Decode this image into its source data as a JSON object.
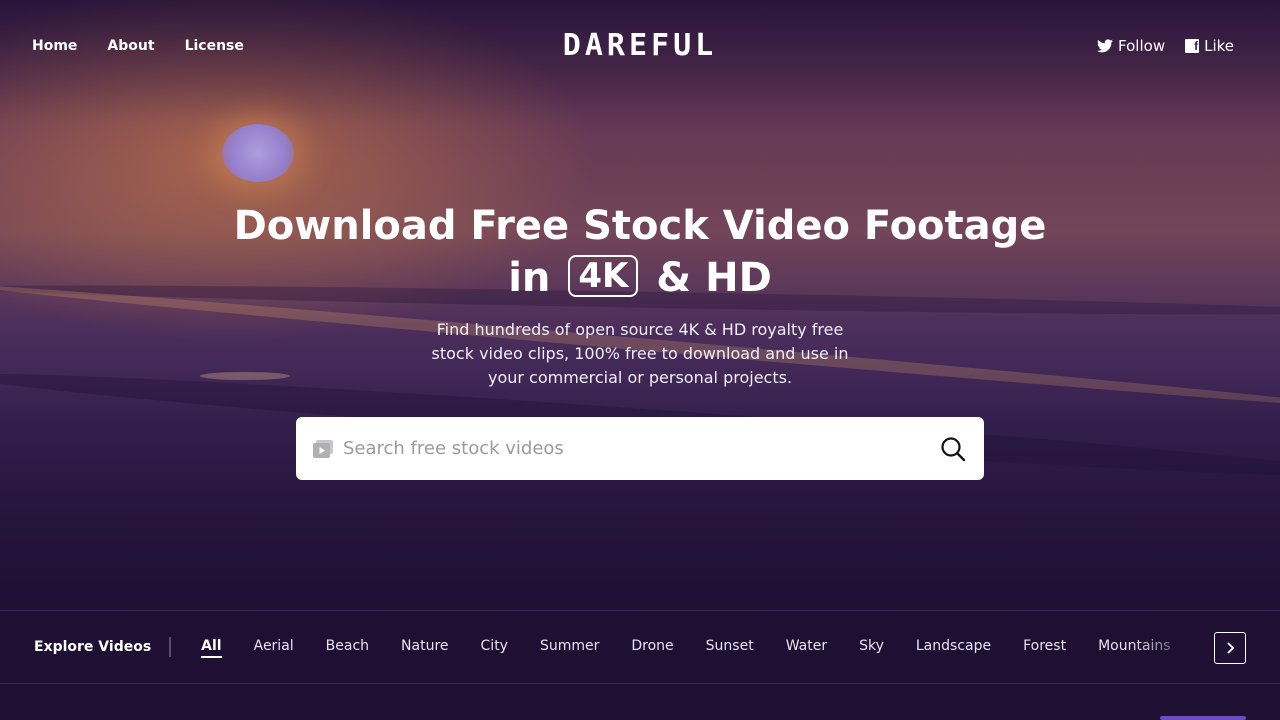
{
  "nav": {
    "links": [
      "Home",
      "About",
      "License"
    ],
    "logo": "DAREFUL",
    "follow_label": "Follow",
    "like_label": "Like"
  },
  "hero": {
    "headline_line1": "Download Free Stock Video Footage",
    "headline_in": "in",
    "badge": "4K",
    "headline_rest": "& HD",
    "subtitle": "Find hundreds of open source 4K & HD royalty free stock video clips, 100% free to download and use in your commercial or personal projects."
  },
  "search": {
    "placeholder": "Search free stock videos"
  },
  "explore": {
    "label": "Explore Videos",
    "categories": [
      "All",
      "Aerial",
      "Beach",
      "Nature",
      "City",
      "Summer",
      "Drone",
      "Sunset",
      "Water",
      "Sky",
      "Landscape",
      "Forest",
      "Mountains"
    ],
    "active": "All"
  },
  "icons": {
    "twitter": "twitter-icon",
    "facebook": "facebook-icon",
    "video": "video-icon",
    "search": "search-icon",
    "next": "chevron-right-icon"
  }
}
